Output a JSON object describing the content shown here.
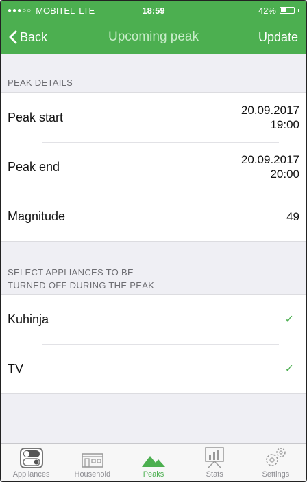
{
  "status_bar": {
    "carrier": "MOBITEL",
    "network": "LTE",
    "time": "18:59",
    "battery": "42%",
    "battery_level": 0.42
  },
  "nav": {
    "back_label": "Back",
    "title": "Upcoming peak",
    "update_label": "Update"
  },
  "peak_details": {
    "header": "PEAK DETAILS",
    "rows": [
      {
        "label": "Peak start",
        "date": "20.09.2017",
        "time": "19:00"
      },
      {
        "label": "Peak end",
        "date": "20.09.2017",
        "time": "20:00"
      },
      {
        "label": "Magnitude",
        "value": "49"
      }
    ]
  },
  "appliances": {
    "header_line1": "SELECT APPLIANCES TO BE",
    "header_line2": "TURNED OFF DURING THE PEAK",
    "items": [
      {
        "label": "Kuhinja",
        "check": "✓"
      },
      {
        "label": "TV",
        "check": "✓"
      }
    ]
  },
  "tabs": [
    {
      "label": "Appliances",
      "icon": "toggle-switch-icon"
    },
    {
      "label": "Household",
      "icon": "house-icon"
    },
    {
      "label": "Peaks",
      "icon": "mountain-peaks-icon",
      "active": true
    },
    {
      "label": "Stats",
      "icon": "chart-board-icon"
    },
    {
      "label": "Settings",
      "icon": "gears-icon"
    }
  ],
  "colors": {
    "accent": "#4caf50",
    "background": "#efeff4"
  }
}
